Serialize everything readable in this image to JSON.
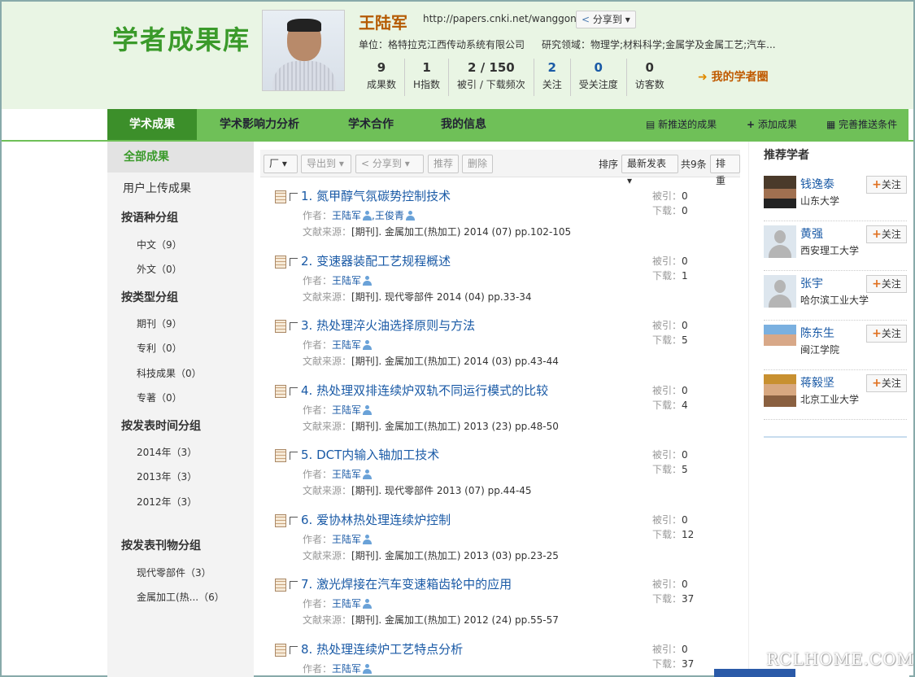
{
  "header": {
    "logo": "学者成果库",
    "name": "王陆军",
    "url": "http://papers.cnki.net/wanggonglj",
    "share": "分享到",
    "unit": "单位：格特拉克江西传动系统有限公司",
    "field": "研究领域：物理学;材料科学;金属学及金属工艺;汽车...",
    "stats": [
      {
        "num": "9",
        "label": "成果数"
      },
      {
        "num": "1",
        "label": "H指数"
      },
      {
        "num": "2 / 150",
        "label": "被引 / 下载频次"
      },
      {
        "num": "2",
        "label": "关注"
      },
      {
        "num": "0",
        "label": "受关注度"
      },
      {
        "num": "0",
        "label": "访客数"
      }
    ],
    "circle": "我的学者圈"
  },
  "nav": {
    "tabs": [
      "学术成果",
      "学术影响力分析",
      "学术合作",
      "我的信息"
    ],
    "actions": [
      "新推送的成果",
      "添加成果",
      "完善推送条件"
    ]
  },
  "left": {
    "all": "全部成果",
    "upload": "用户上传成果",
    "groups": [
      {
        "title": "按语种分组",
        "items": [
          "中文（9）",
          "外文（0）"
        ]
      },
      {
        "title": "按类型分组",
        "items": [
          "期刊（9）",
          "专利（0）",
          "科技成果（0）",
          "专著（0）"
        ]
      },
      {
        "title": "按发表时间分组",
        "items": [
          "2014年（3）",
          "2013年（3）",
          "2012年（3）"
        ]
      },
      {
        "title": "按发表刊物分组",
        "items": [
          "现代零部件（3）",
          "金属加工(热...（6）"
        ]
      }
    ]
  },
  "toolbar": {
    "select": "厂",
    "export": "导出到",
    "share": "分享到",
    "recommend": "推荐",
    "delete": "删除",
    "sort_label": "排序",
    "sort_value": "最新发表",
    "count": "共9条",
    "reorder": "排重"
  },
  "labels": {
    "author": "作者：",
    "source": "文献来源：",
    "cite": "被引：",
    "download": "下载："
  },
  "papers": [
    {
      "idx": "1.",
      "title": "氮甲醇气氛碳势控制技术",
      "authors": [
        "王陆军",
        ",王俊青"
      ],
      "source": "[期刊]. 金属加工(热加工) 2014 (07) pp.102-105",
      "cite": "0",
      "download": "0"
    },
    {
      "idx": "2.",
      "title": "变速器装配工艺规程概述",
      "authors": [
        "王陆军"
      ],
      "source": "[期刊]. 现代零部件 2014 (04) pp.33-34",
      "cite": "0",
      "download": "1"
    },
    {
      "idx": "3.",
      "title": "热处理淬火油选择原则与方法",
      "authors": [
        "王陆军"
      ],
      "source": "[期刊]. 金属加工(热加工) 2014 (03) pp.43-44",
      "cite": "0",
      "download": "5"
    },
    {
      "idx": "4.",
      "title": "热处理双排连续炉双轨不同运行模式的比较",
      "authors": [
        "王陆军"
      ],
      "source": "[期刊]. 金属加工(热加工) 2013 (23) pp.48-50",
      "cite": "0",
      "download": "4"
    },
    {
      "idx": "5.",
      "title": "DCT内输入轴加工技术",
      "authors": [
        "王陆军"
      ],
      "source": "[期刊]. 现代零部件 2013 (07) pp.44-45",
      "cite": "0",
      "download": "5"
    },
    {
      "idx": "6.",
      "title": "爱协林热处理连续炉控制",
      "authors": [
        "王陆军"
      ],
      "source": "[期刊]. 金属加工(热加工) 2013 (03) pp.23-25",
      "cite": "0",
      "download": "12"
    },
    {
      "idx": "7.",
      "title": "激光焊接在汽车变速箱齿轮中的应用",
      "authors": [
        "王陆军"
      ],
      "source": "[期刊]. 金属加工(热加工) 2012 (24) pp.55-57",
      "cite": "0",
      "download": "37"
    },
    {
      "idx": "8.",
      "title": "热处理连续炉工艺特点分析",
      "authors": [
        "王陆军"
      ],
      "source": "",
      "cite": "0",
      "download": "37"
    }
  ],
  "right": {
    "title": "推荐学者",
    "follow": "关注",
    "scholars": [
      {
        "name": "钱逸泰",
        "unit": "山东大学"
      },
      {
        "name": "黄强",
        "unit": "西安理工大学"
      },
      {
        "name": "张宇",
        "unit": "哈尔滨工业大学"
      },
      {
        "name": "陈东生",
        "unit": "闽江学院"
      },
      {
        "name": "蒋毅坚",
        "unit": "北京工业大学"
      }
    ]
  },
  "watermark": "RCLHOME.COM"
}
